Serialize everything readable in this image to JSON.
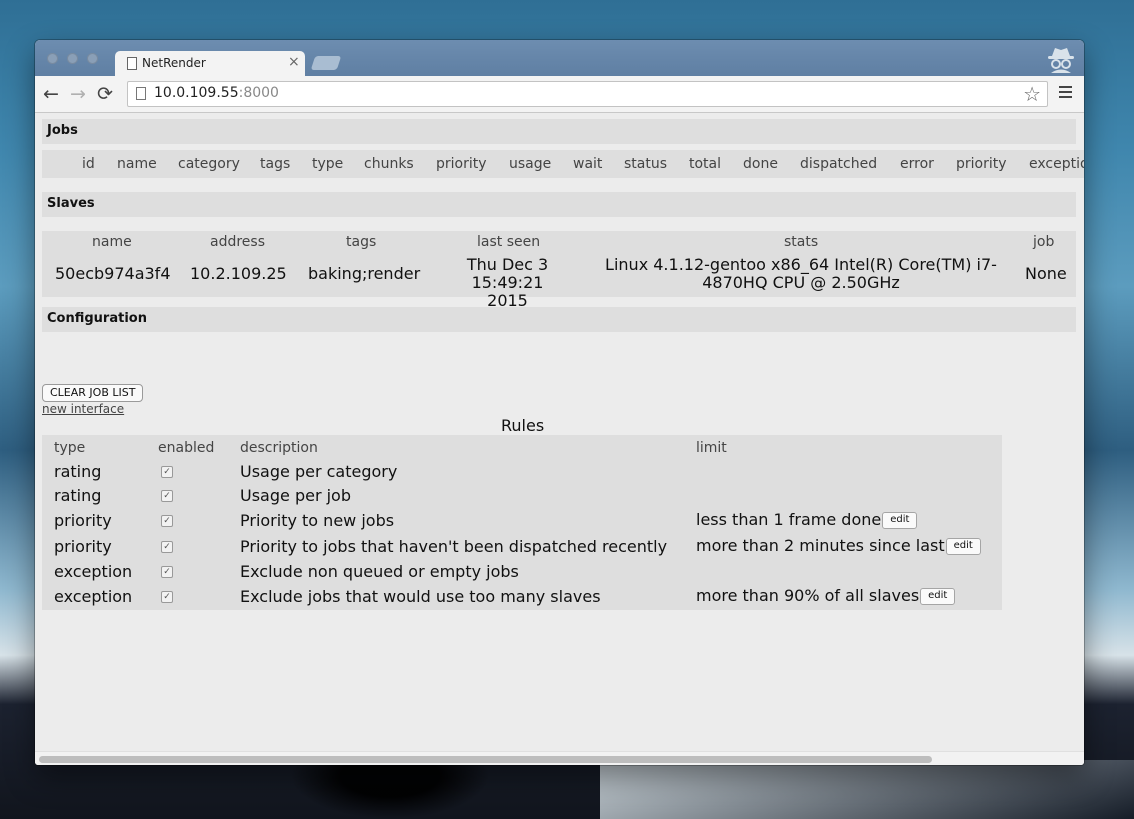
{
  "browser": {
    "tab_title": "NetRender",
    "tab_close": "×",
    "url_host": "10.0.109.55",
    "url_port": ":8000",
    "back": "←",
    "forward": "→",
    "reload": "⟳",
    "bookmark": "☆",
    "accent_color": "#6d8db0"
  },
  "jobs": {
    "title": "Jobs",
    "columns": [
      "id",
      "name",
      "category",
      "tags",
      "type",
      "chunks",
      "priority",
      "usage",
      "wait",
      "status",
      "total",
      "done",
      "dispatched",
      "error",
      "priority",
      "exception"
    ]
  },
  "slaves": {
    "title": "Slaves",
    "columns": [
      "name",
      "address",
      "tags",
      "last seen",
      "stats",
      "job"
    ],
    "rows": [
      {
        "name": "50ecb974a3f4",
        "address": "10.2.109.25",
        "tags": "baking;render",
        "last_seen_1": "Thu Dec 3",
        "last_seen_2": "15:49:21 2015",
        "stats_1": "Linux 4.1.12-gentoo x86_64 Intel(R) Core(TM) i7-",
        "stats_2": "4870HQ CPU @ 2.50GHz",
        "job": "None"
      }
    ]
  },
  "configuration": {
    "title": "Configuration",
    "clear_button": "CLEAR JOB LIST",
    "new_interface_link": "new interface",
    "rules_title": "Rules",
    "rules_columns": [
      "type",
      "enabled",
      "description",
      "limit"
    ],
    "edit_label": "edit",
    "rules": [
      {
        "type": "rating",
        "enabled": true,
        "description": "Usage per category",
        "limit": ""
      },
      {
        "type": "rating",
        "enabled": true,
        "description": "Usage per job",
        "limit": ""
      },
      {
        "type": "priority",
        "enabled": true,
        "description": "Priority to new jobs",
        "limit": "less than 1 frame done"
      },
      {
        "type": "priority",
        "enabled": true,
        "description": "Priority to jobs that haven't been dispatched recently",
        "limit": "more than 2 minutes since last"
      },
      {
        "type": "exception",
        "enabled": true,
        "description": "Exclude non queued or empty jobs",
        "limit": ""
      },
      {
        "type": "exception",
        "enabled": true,
        "description": "Exclude jobs that would use too many slaves",
        "limit": "more than 90% of all slaves"
      }
    ]
  }
}
